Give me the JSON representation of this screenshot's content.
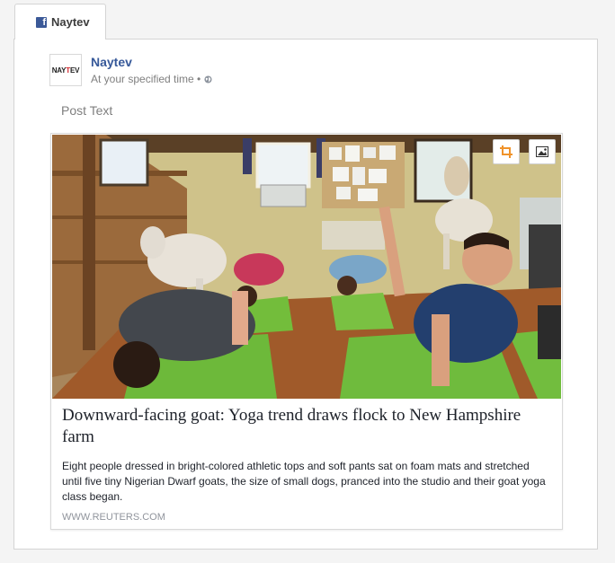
{
  "tab": {
    "label": "Naytev",
    "icon": "facebook-icon"
  },
  "post": {
    "avatar": {
      "text_prefix": "NAY",
      "text_accent": "T",
      "text_suffix": "EV"
    },
    "page_name": "Naytev",
    "schedule": "At your specified time •",
    "privacy_icon": "globe-icon",
    "post_text": "Post Text"
  },
  "link_card": {
    "image_alt": "Yoga class with goats in a barn studio",
    "buttons": {
      "crop_icon": "crop-icon",
      "image_icon": "image-icon"
    },
    "headline": "Downward-facing goat: Yoga trend draws flock to New Hampshire farm",
    "description": "Eight people dressed in bright-colored athletic tops and soft pants sat on foam mats and stretched until five tiny Nigerian Dwarf goats, the size of small dogs, pranced into the studio and their goat yoga class began.",
    "domain": "WWW.REUTERS.COM"
  },
  "colors": {
    "brand": "#3b5998",
    "link": "#365899",
    "crop_accent": "#f0932b"
  }
}
